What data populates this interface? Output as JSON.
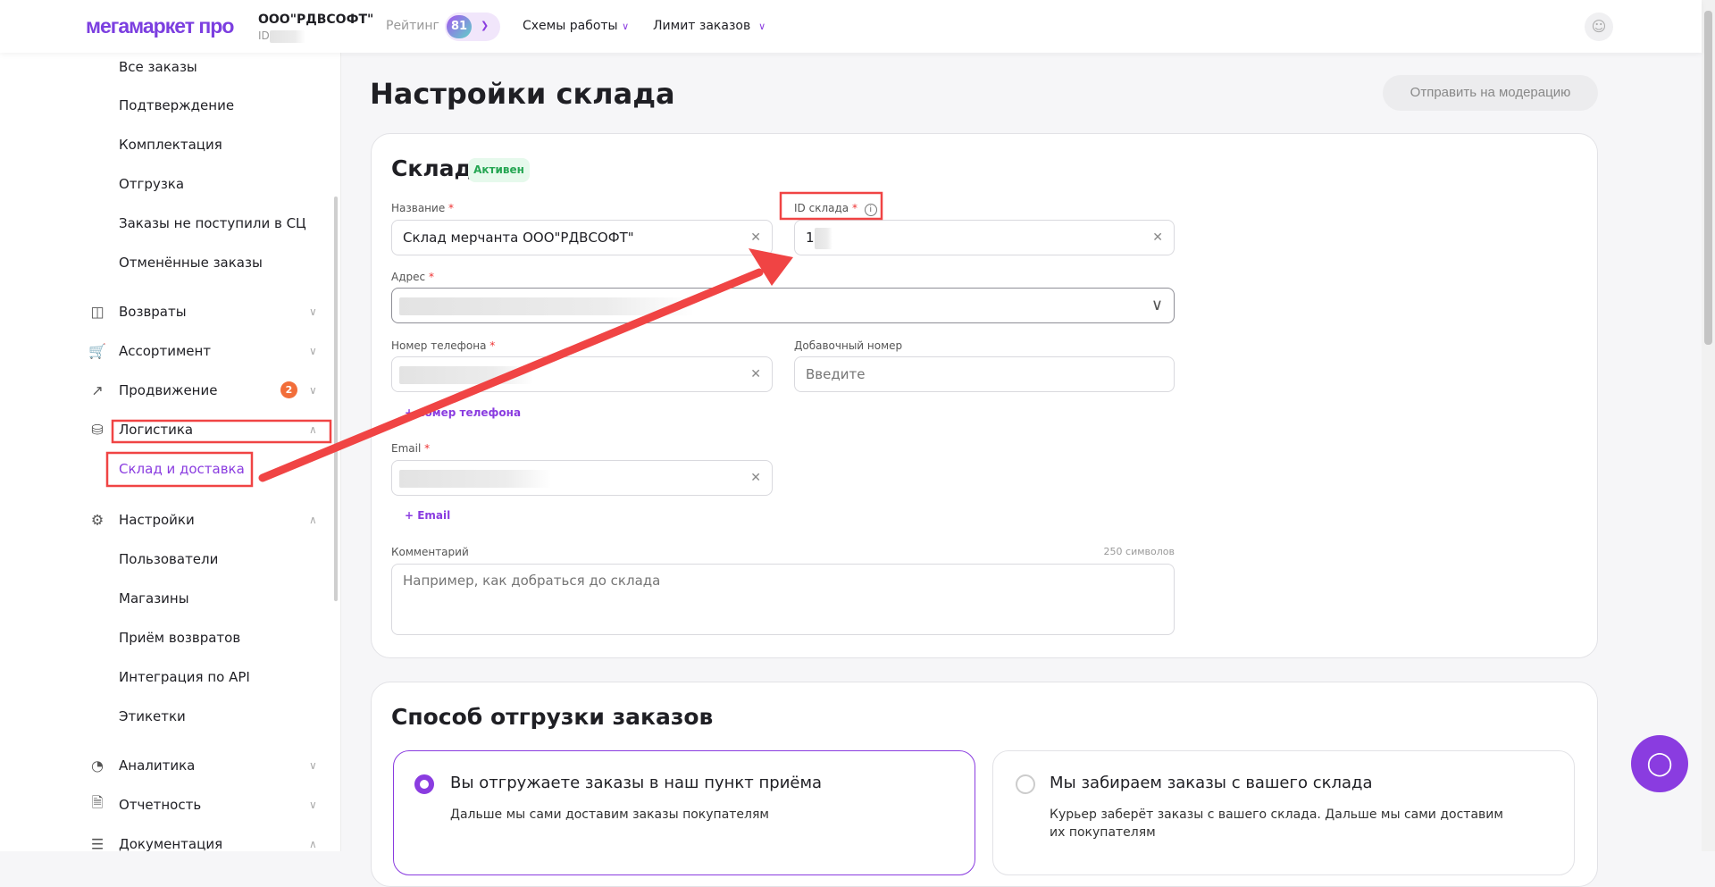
{
  "header": {
    "logo": "мегамаркет про",
    "company": "ООО\"РДВСОФТ\"",
    "company_id_label": "ID",
    "rating_label": "Рейтинг",
    "rating_value": "81",
    "menu": [
      "Схемы работы",
      "Лимит заказов"
    ]
  },
  "sidebar": {
    "items": [
      {
        "label": "Все заказы"
      },
      {
        "label": "Подтверждение"
      },
      {
        "label": "Комплектация"
      },
      {
        "label": "Отгрузка"
      },
      {
        "label": "Заказы не поступили в СЦ"
      },
      {
        "label": "Отменённые заказы"
      },
      {
        "label": "Возвраты"
      },
      {
        "label": "Ассортимент"
      },
      {
        "label": "Продвижение",
        "badge": "2"
      },
      {
        "label": "Логистика"
      },
      {
        "label": "Склад и доставка"
      },
      {
        "label": "Настройки"
      },
      {
        "label": "Пользователи"
      },
      {
        "label": "Магазины"
      },
      {
        "label": "Приём возвратов"
      },
      {
        "label": "Интеграция по API"
      },
      {
        "label": "Этикетки"
      },
      {
        "label": "Аналитика"
      },
      {
        "label": "Отчетность"
      },
      {
        "label": "Документация"
      }
    ]
  },
  "page": {
    "title": "Настройки склада",
    "moderation_button": "Отправить на модерацию"
  },
  "warehouse": {
    "title": "Склад",
    "status": "Активен",
    "name_label": "Название",
    "name_value": "Склад мерчанта ООО\"РДВСОФТ\"",
    "id_label": "ID склада",
    "id_value": "1",
    "address_label": "Адрес",
    "phone_label": "Номер телефона",
    "ext_label": "Добавочный номер",
    "ext_placeholder": "Введите",
    "add_phone": "номер телефона",
    "email_label": "Email",
    "add_email": "Email",
    "comment_label": "Комментарий",
    "comment_limit": "250 символов",
    "comment_placeholder": "Например, как добраться до склада",
    "required_mark": "*"
  },
  "shipping": {
    "title": "Способ отгрузки заказов",
    "options": [
      {
        "title": "Вы отгружаете заказы в наш пункт приёма",
        "desc": "Дальше мы сами доставим заказы покупателям",
        "selected": true
      },
      {
        "title": "Мы забираем заказы с вашего склада",
        "desc": "Курьер заберёт заказы с вашего склада. Дальше мы сами доставим их покупателям",
        "selected": false
      }
    ]
  },
  "colors": {
    "accent": "#8a3ce0",
    "annotation": "#f04444",
    "active": "#26a653"
  }
}
